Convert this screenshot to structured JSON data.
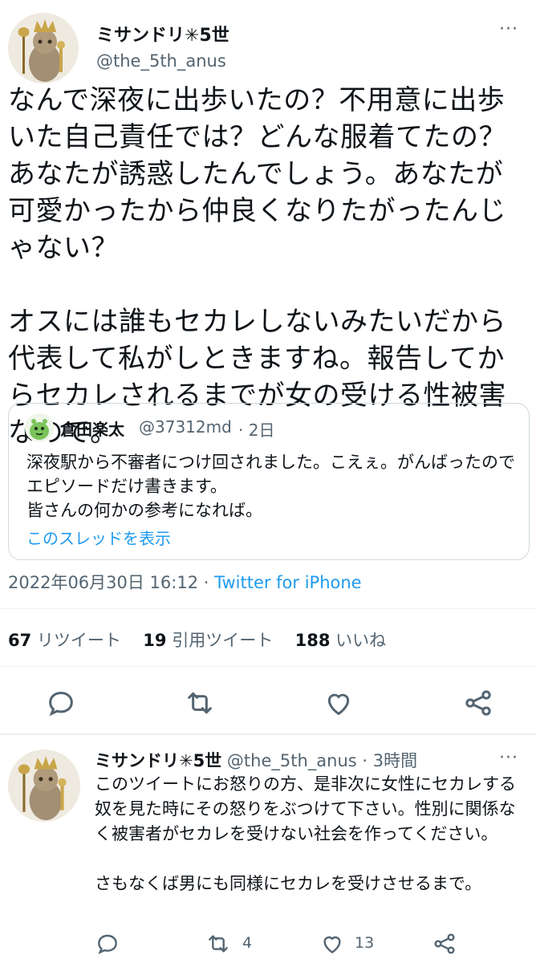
{
  "tweet": {
    "author_name": "ミサンドリ✳︎5世",
    "author_handle": "@the_5th_anus",
    "more_icon": "more-dots-icon",
    "text": "なんで深夜に出歩いたの？不用意に出歩いた自己責任では？どんな服着てたの？あなたが誘惑したんでしょう。あなたが可愛かったから仲良くなりたがったんじゃない？\n\nオスには誰もセカレしないみたいだから代表して私がしときますね。報告してからセカレされるまでが女の受ける性被害なので。",
    "quoted": {
      "author_name": "倉田楽太",
      "author_handle": "@37312md",
      "time": "· 2日",
      "text": "深夜駅から不審者につけ回されました。こえぇ。がんばったのでエピソードだけ書きます。\n皆さんの何かの参考になれば。",
      "show_thread": "このスレッドを表示"
    },
    "timestamp": "2022年06月30日 16:12 · ",
    "source": "Twitter for iPhone",
    "stats": {
      "retweets_count": "67",
      "retweets_label": "リツイート",
      "quotes_count": "19",
      "quotes_label": "引用ツイート",
      "likes_count": "188",
      "likes_label": "いいね"
    },
    "actions": [
      "reply-icon",
      "retweet-icon",
      "like-icon",
      "share-icon"
    ]
  },
  "reply": {
    "author_name": "ミサンドリ✳︎5世",
    "author_handle": "@the_5th_anus",
    "time": "· 3時間",
    "text": "このツイートにお怒りの方、是非次に女性にセカレする奴を見た時にその怒りをぶつけて下さい。性別に関係なく被害者がセカレを受けない社会を作ってください。\n\nさもなくば男にも同様にセカレを受けさせるまで。",
    "retweet_count": "4",
    "like_count": "13"
  },
  "colors": {
    "accent": "#1d9bf0",
    "muted": "#536471",
    "border": "#cfd9de"
  }
}
